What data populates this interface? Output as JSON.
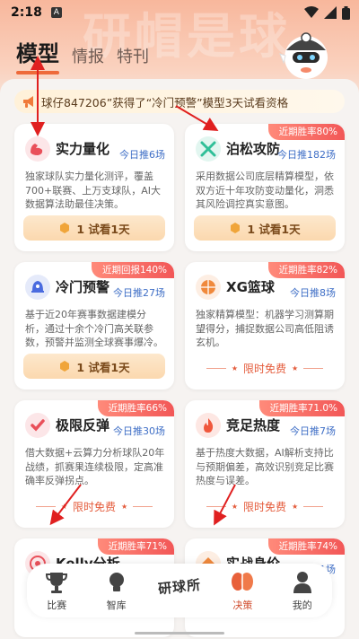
{
  "status_bar": {
    "time": "2:18",
    "app_badge": "A"
  },
  "hero": {
    "watermark": "研帽是球"
  },
  "tabs": [
    {
      "label": "模型",
      "active": true
    },
    {
      "label": "情报",
      "active": false
    },
    {
      "label": "特刊",
      "active": false
    }
  ],
  "notice": {
    "text": "球仔847206”获得了“冷门预警”模型3天试看资格"
  },
  "cards": [
    {
      "ribbon": "",
      "title": "实力量化",
      "today": "今日推6场",
      "desc": "独家球队实力量化测评，覆盖700+联赛、上万支球队，AI大数据算法助最佳决策。",
      "action_type": "trial",
      "action_label": "1 试看1天",
      "icon": "bicep-icon",
      "color": "#e9505a"
    },
    {
      "ribbon": "近期胜率80%",
      "title": "泊松攻防",
      "today": "今日推182场",
      "desc": "采用数据公司底层精算模型，依双方近十年攻防变动量化，洞悉其风险调控真实意图。",
      "action_type": "trial",
      "action_label": "1 试看1天",
      "icon": "crossed-swords-icon",
      "color": "#2fbf98"
    },
    {
      "ribbon": "近期回报140%",
      "title": "冷门预警",
      "today": "今日推27场",
      "desc": "基于近20年赛事数据建模分析，通过十余个冷门高关联参数，预警并监测全球赛事爆冷。",
      "action_type": "trial",
      "action_label": "1 试看1天",
      "icon": "bell-star-icon",
      "color": "#4a6bdf"
    },
    {
      "ribbon": "近期胜率82%",
      "title": "XG篮球",
      "today": "今日推8场",
      "desc": "独家精算模型：机器学习测算期望得分，捕捉数据公司高低阻诱玄机。",
      "action_type": "free",
      "action_label": "限时免费",
      "icon": "basketball-icon",
      "color": "#f0893c"
    },
    {
      "ribbon": "近期胜率66%",
      "title": "极限反弹",
      "today": "今日推30场",
      "desc": "借大数据+云算力分析球队20年战绩，抓赛果连续极限，定高准确率反弹拐点。",
      "action_type": "free",
      "action_label": "限时免费",
      "icon": "check-mark-icon",
      "color": "#e9505a"
    },
    {
      "ribbon": "近期胜率71.0%",
      "title": "竞足热度",
      "today": "今日推7场",
      "desc": "基于热度大数据，AI解析支持比与预期偏差，高效识别竞足比赛热度与误差。",
      "action_type": "free",
      "action_label": "限时免费",
      "icon": "flame-icon",
      "color": "#f0573c"
    },
    {
      "ribbon": "近期胜率71%",
      "title": "Kelly分析",
      "today": "",
      "desc": "",
      "action_type": "none",
      "action_label": "",
      "icon": "target-icon",
      "color": "#e9505a"
    },
    {
      "ribbon": "近期胜率74%",
      "title": "实战身价",
      "today": "今日推11场",
      "desc": "",
      "action_type": "none",
      "action_label": "",
      "icon": "diamond-icon",
      "color": "#f0893c"
    }
  ],
  "bottom_nav": {
    "items": [
      {
        "label": "比赛",
        "icon": "trophy-icon"
      },
      {
        "label": "智库",
        "icon": "lightbulb-icon"
      },
      {
        "label": "决策",
        "icon": "brain-icon",
        "active": true
      },
      {
        "label": "我的",
        "icon": "user-icon"
      }
    ],
    "center_label": "研球所"
  },
  "colors": {
    "accent": "#ee6a3a",
    "ribbon": "#f25757",
    "link_blue": "#3e6ec6",
    "annotation_red": "#e02020"
  }
}
